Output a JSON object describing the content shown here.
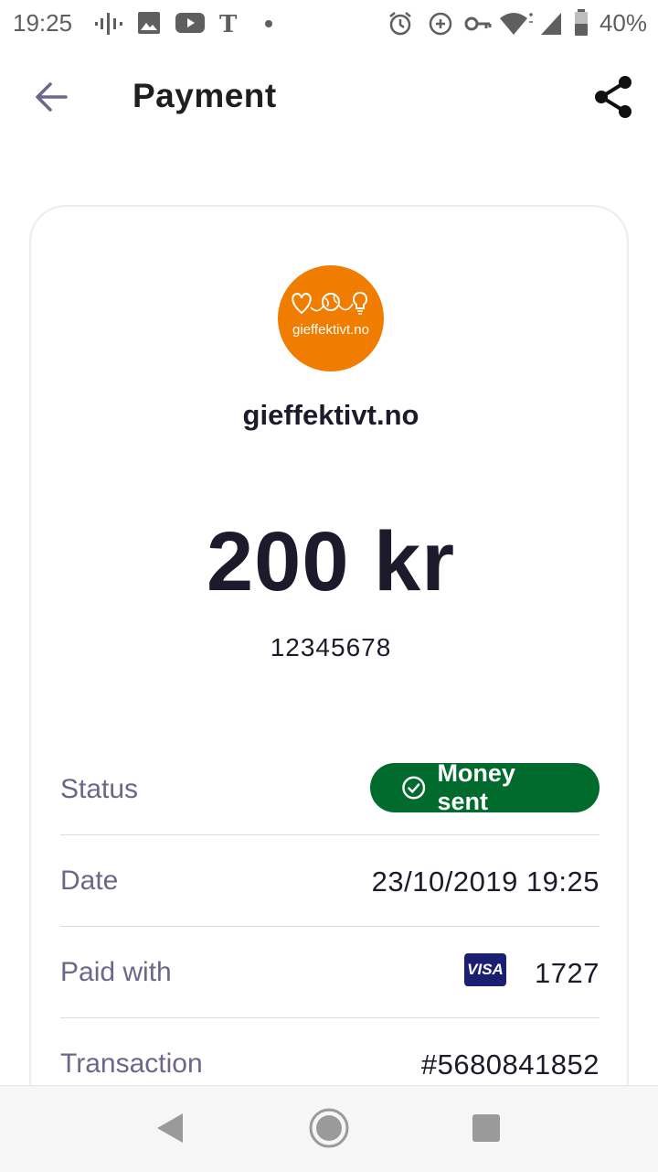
{
  "status_bar": {
    "time": "19:25",
    "battery": "40%",
    "left_icons": [
      "podcast-icon",
      "gallery-icon",
      "youtube-icon",
      "nytimes-icon",
      "dot-icon"
    ],
    "right_icons": [
      "alarm-icon",
      "data-saver-icon",
      "vpn-key-icon",
      "wifi-icon",
      "signal-icon",
      "battery-icon"
    ]
  },
  "app_bar": {
    "title": "Payment",
    "back_icon": "arrow-left-icon",
    "share_icon": "share-icon"
  },
  "payment": {
    "merchant_logo_text": "gieffektivt.no",
    "merchant_name": "gieffektivt.no",
    "amount": "200 kr",
    "reference": "12345678"
  },
  "details": {
    "status_label": "Status",
    "status_value": "Money sent",
    "date_label": "Date",
    "date_value": "23/10/2019 19:25",
    "paid_with_label": "Paid with",
    "card_brand": "VISA",
    "card_last4": "1727",
    "transaction_label": "Transaction",
    "transaction_value": "#5680841852"
  },
  "colors": {
    "brand_orange": "#f07c00",
    "status_green": "#006b2c",
    "label_purple": "#6e6688",
    "visa_blue": "#1a1f71"
  }
}
